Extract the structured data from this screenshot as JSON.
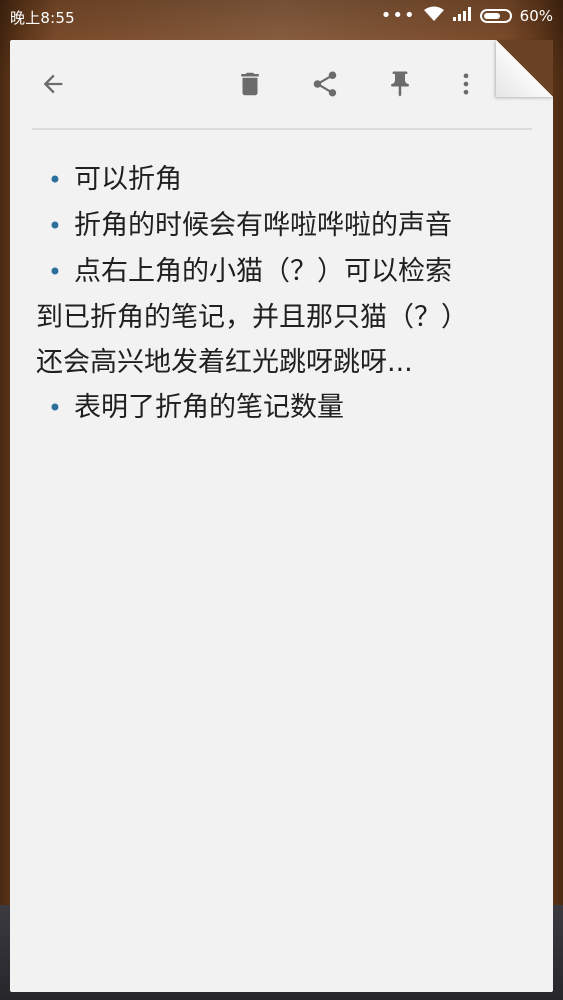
{
  "status_bar": {
    "time": "晚上8:55",
    "signal_dots": "•••",
    "battery": "60%"
  },
  "toolbar": {
    "back_icon": "arrow-left-icon",
    "delete_icon": "trash-icon",
    "share_icon": "share-icon",
    "pin_icon": "pin-icon",
    "more_icon": "more-vert-icon"
  },
  "note": {
    "lines": [
      {
        "bullet": "•",
        "text": "可以折角"
      },
      {
        "bullet": "•",
        "text": "折角的时候会有哗啦哗啦的声音"
      },
      {
        "bullet": "•",
        "text": "点右上角的小猫（？）可以检索"
      },
      {
        "bullet": "",
        "text": "到已折角的笔记，并且那只猫（？）"
      },
      {
        "bullet": "",
        "text": "还会高兴地发着红光跳呀跳呀..."
      },
      {
        "bullet": "•",
        "text": "表明了折角的笔记数量"
      }
    ]
  },
  "colors": {
    "bullet": "#2c6f9c",
    "note_bg": "#f2f2f2",
    "icon": "#6b6b6b"
  }
}
